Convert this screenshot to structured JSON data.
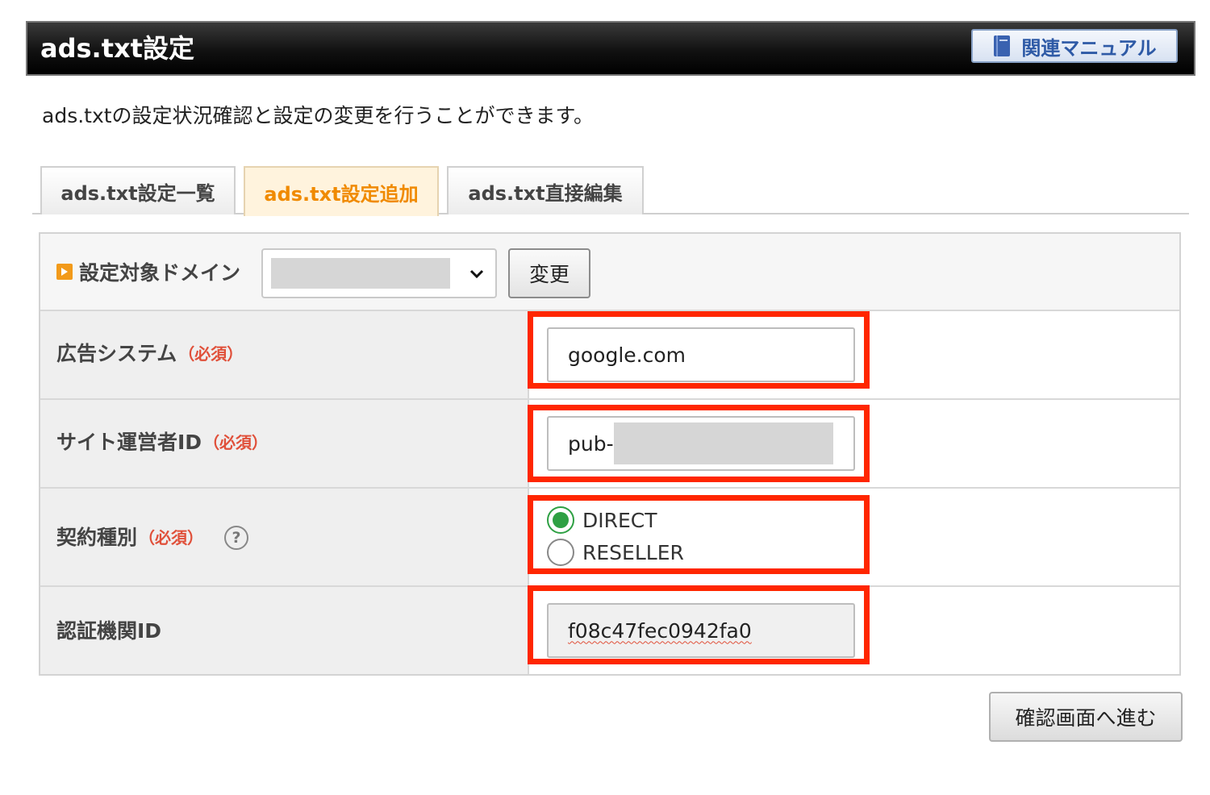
{
  "header": {
    "title": "ads.txt設定",
    "manual_label": "関連マニュアル"
  },
  "description": "ads.txtの設定状況確認と設定の変更を行うことができます。",
  "tabs": [
    {
      "label": "ads.txt設定一覧",
      "active": false
    },
    {
      "label": "ads.txt設定追加",
      "active": true
    },
    {
      "label": "ads.txt直接編集",
      "active": false
    }
  ],
  "domain": {
    "label": "設定対象ドメイン",
    "selected_value": "",
    "change_label": "変更"
  },
  "fields": {
    "ad_system": {
      "label": "広告システム",
      "required": "（必須）",
      "value": "google.com"
    },
    "publisher_id": {
      "label": "サイト運営者ID",
      "required": "（必須）",
      "value": "pub-"
    },
    "contract_type": {
      "label": "契約種別",
      "required": "（必須）",
      "help": "?",
      "options": [
        {
          "label": "DIRECT",
          "checked": true
        },
        {
          "label": "RESELLER",
          "checked": false
        }
      ]
    },
    "cert_id": {
      "label": "認証機関ID",
      "value": "f08c47fec0942fa0"
    }
  },
  "submit_label": "確認画面へ進む",
  "colors": {
    "accent": "#f08a00",
    "highlight": "#ff2600",
    "required": "#e0503a",
    "radio_selected": "#2ea043",
    "link": "#2e5aa6"
  }
}
